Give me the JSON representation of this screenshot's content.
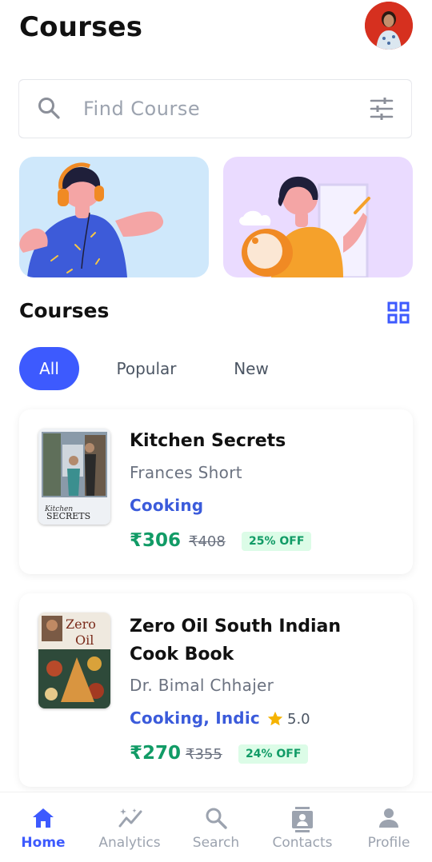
{
  "header": {
    "title": "Courses"
  },
  "search": {
    "placeholder": "Find Course"
  },
  "section": {
    "title": "Courses"
  },
  "tabs": [
    {
      "label": "All",
      "active": true
    },
    {
      "label": "Popular",
      "active": false
    },
    {
      "label": "New",
      "active": false
    }
  ],
  "courses": [
    {
      "title": "Kitchen Secrets",
      "author": "Frances Short",
      "category": "Cooking",
      "price": "₹306",
      "old_price": "₹408",
      "discount": "25% OFF",
      "cover_text": "Kitchen SECRETS"
    },
    {
      "title": "Zero Oil South Indian Cook Book",
      "author": "Dr. Bimal Chhajer",
      "category": "Cooking, Indic",
      "rating": "5.0",
      "price": "₹270",
      "old_price": "₹355",
      "discount": "24% OFF",
      "cover_text": "Zero Oil"
    }
  ],
  "nav": [
    {
      "label": "Home",
      "icon": "home-icon",
      "active": true
    },
    {
      "label": "Analytics",
      "icon": "analytics-icon",
      "active": false
    },
    {
      "label": "Search",
      "icon": "search-icon",
      "active": false
    },
    {
      "label": "Contacts",
      "icon": "contacts-icon",
      "active": false
    },
    {
      "label": "Profile",
      "icon": "profile-icon",
      "active": false
    }
  ],
  "colors": {
    "accent": "#3d5afe",
    "price": "#119b66",
    "category": "#3b5bdb",
    "banner1": "#cfe8fb",
    "banner2": "#eadbff"
  }
}
